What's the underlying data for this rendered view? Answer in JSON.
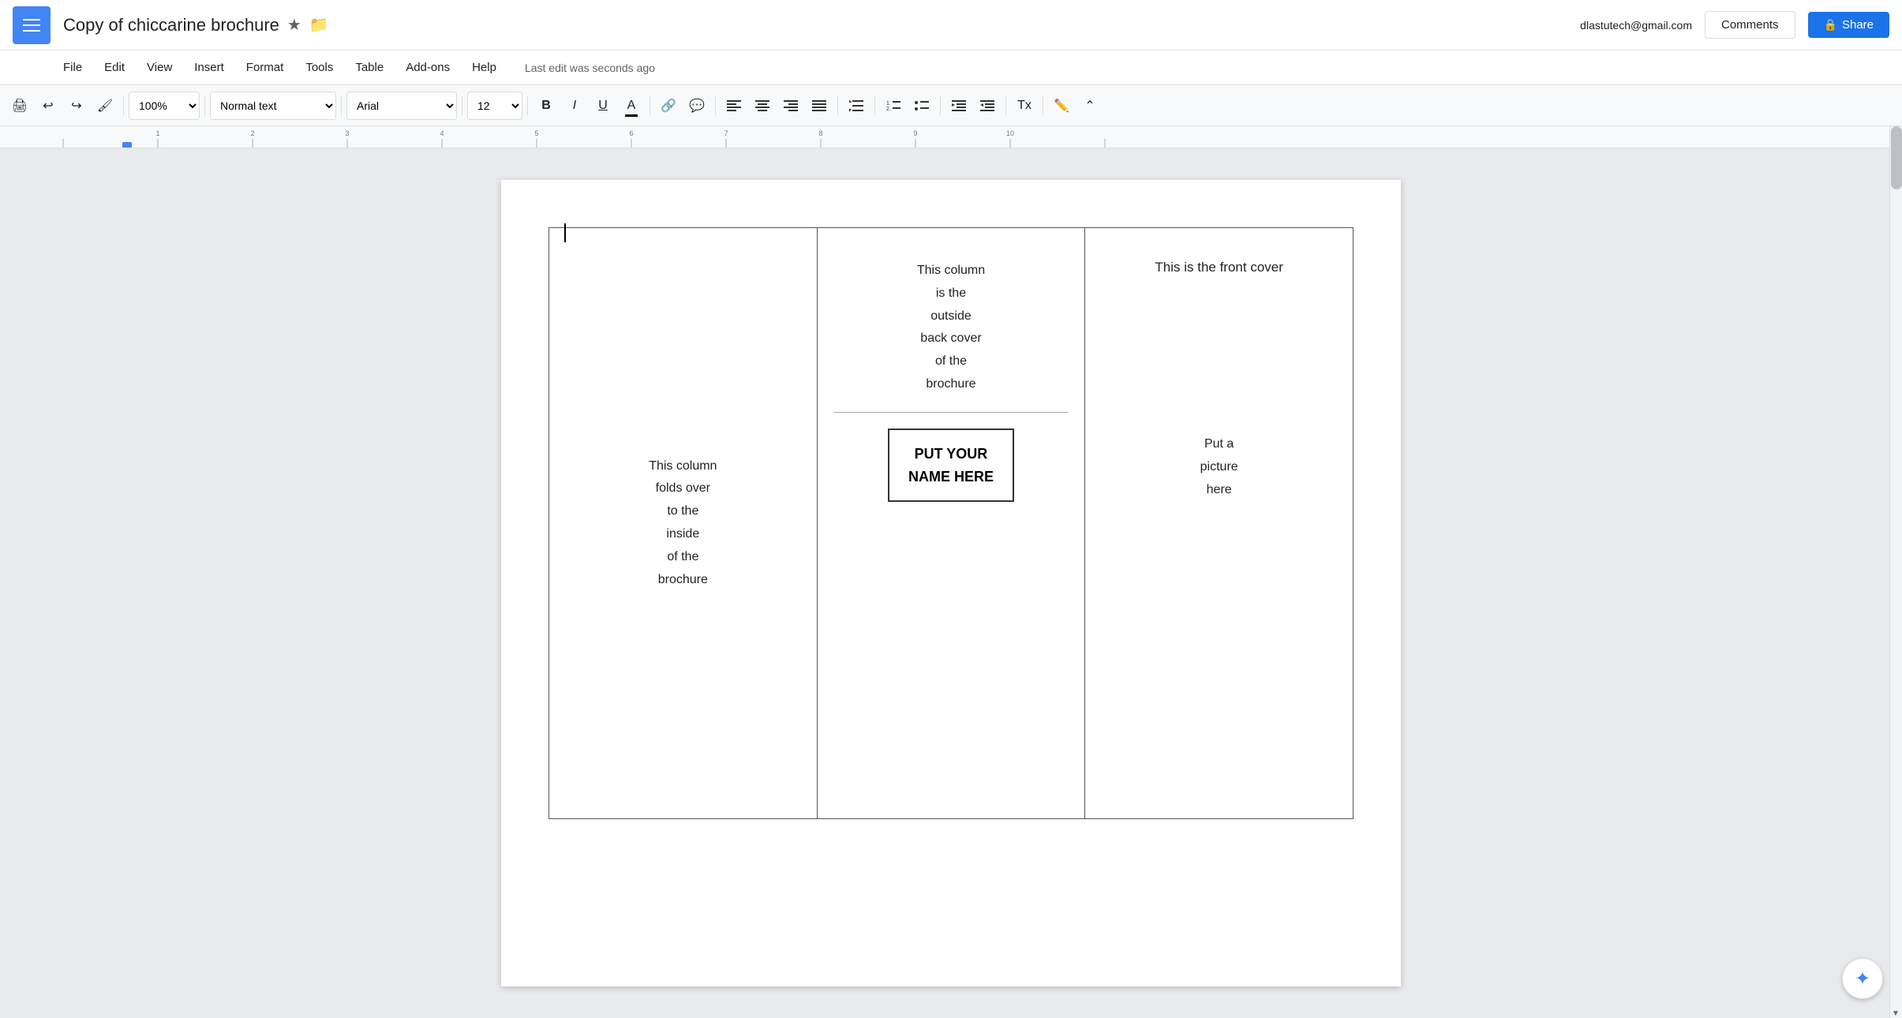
{
  "topbar": {
    "doc_title": "Copy of chiccarine brochure",
    "star_icon": "★",
    "folder_icon": "📁",
    "user_email": "dlastutech@gmail.com",
    "comments_label": "Comments",
    "share_label": "Share"
  },
  "menubar": {
    "items": [
      "File",
      "Edit",
      "View",
      "Insert",
      "Format",
      "Tools",
      "Table",
      "Add-ons",
      "Help"
    ],
    "last_edit": "Last edit was seconds ago"
  },
  "toolbar": {
    "print_icon": "🖨",
    "undo_icon": "↩",
    "redo_icon": "↪",
    "paint_icon": "🎨",
    "zoom_value": "100%",
    "style_value": "Normal text",
    "font_value": "Arial",
    "font_size_value": "12",
    "bold_label": "B",
    "italic_label": "I",
    "underline_label": "U",
    "link_icon": "🔗",
    "comment_icon": "💬",
    "align_left": "≡",
    "align_center": "≡",
    "align_right": "≡",
    "align_justify": "≡",
    "line_spacing": "↕",
    "list_number": "1.",
    "list_bullet": "•",
    "indent_dec": "⇤",
    "indent_inc": "⇥",
    "clear_format": "✕",
    "pen_icon": "✏",
    "chevron_up": "˄"
  },
  "brochure": {
    "col1_text": "This column\nfolds over\nto the\ninside\nof the\nbrochure",
    "col2_back_text": "This column\nis the\noutside\nback cover\nof the\nbrochure",
    "col2_name_line1": "PUT YOUR",
    "col2_name_line2": "NAME HERE",
    "col3_front_text": "This is the front cover",
    "col3_picture_text": "Put a\npicture\nhere"
  },
  "scrollbar": {
    "up_arrow": "▲",
    "down_arrow": "▼"
  },
  "ai_button": {
    "icon": "✦"
  }
}
